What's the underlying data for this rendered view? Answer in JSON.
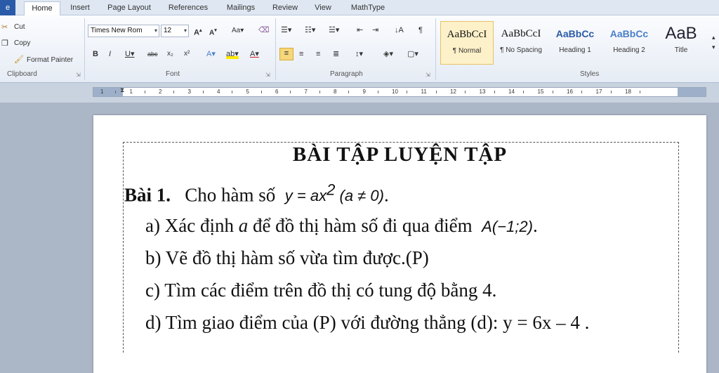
{
  "tabs": {
    "file": "e",
    "items": [
      "Home",
      "Insert",
      "Page Layout",
      "References",
      "Mailings",
      "Review",
      "View",
      "MathType"
    ]
  },
  "clipboard": {
    "cut": "Cut",
    "copy": "Copy",
    "format_painter": "Format Painter",
    "label": "Clipboard"
  },
  "font": {
    "name": "Times New Rom",
    "size": "12",
    "label": "Font"
  },
  "paragraph": {
    "label": "Paragraph"
  },
  "styles": {
    "label": "Styles",
    "items": [
      {
        "preview": "AaBbCcI",
        "name": "¶ Normal"
      },
      {
        "preview": "AaBbCcI",
        "name": "¶ No Spacing"
      },
      {
        "preview": "AaBbCc",
        "name": "Heading 1"
      },
      {
        "preview": "AaBbCc",
        "name": "Heading 2"
      },
      {
        "preview": "AaB",
        "name": "Title"
      }
    ]
  },
  "ruler": {
    "numbers": [
      "1",
      "1",
      "2",
      "3",
      "4",
      "5",
      "6",
      "7",
      "8",
      "9",
      "10",
      "11",
      "12",
      "13",
      "14",
      "15",
      "16",
      "17",
      "18"
    ]
  },
  "document": {
    "title": "BÀI TẬP LUYỆN TẬP",
    "bai_label": "Bài 1.",
    "intro": "Cho hàm số",
    "eq_y": "y",
    "eq_mid": " = ",
    "eq_ax": "ax",
    "eq_exp": "2",
    "eq_cond_a": "a",
    "eq_cond_rest": " ≠ 0",
    "period": ".",
    "item_a_prefix": "a) Xác định ",
    "item_a_var": "a",
    "item_a_suffix": " để đồ thị hàm số đi qua điểm",
    "point_name": "A",
    "point_coords": "(−1;2)",
    "item_b": "b) Vẽ đồ thị hàm số vừa tìm được.(P)",
    "item_c": "c) Tìm các điểm trên đồ thị có tung độ bằng 4.",
    "item_d": "d) Tìm giao điểm của (P) với đường thẳng (d): y = 6x – 4 ."
  },
  "colors": {
    "file_tab": "#2a5ba8",
    "style_highlight": "#fdf1c9",
    "heading_blue": "#2a5ba8"
  }
}
